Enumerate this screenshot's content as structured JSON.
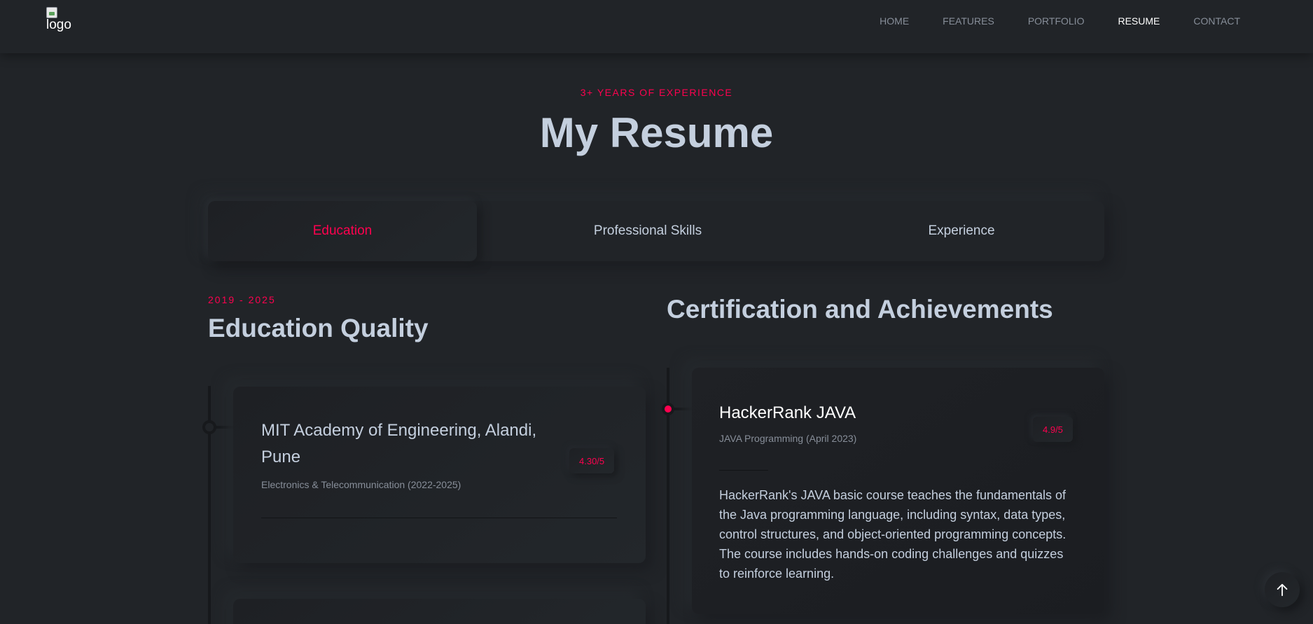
{
  "header": {
    "logo_alt": "logo",
    "nav": [
      {
        "label": "HOME",
        "active": false
      },
      {
        "label": "FEATURES",
        "active": false
      },
      {
        "label": "PORTFOLIO",
        "active": false
      },
      {
        "label": "RESUME",
        "active": true
      },
      {
        "label": "CONTACT",
        "active": false
      }
    ]
  },
  "hero": {
    "subtitle": "3+ YEARS OF EXPERIENCE",
    "title": "My Resume"
  },
  "tabs": [
    {
      "label": "Education",
      "active": true
    },
    {
      "label": "Professional Skills",
      "active": false
    },
    {
      "label": "Experience",
      "active": false
    }
  ],
  "education": {
    "period": "2019 - 2025",
    "title": "Education Quality",
    "items": [
      {
        "heading": "MIT Academy of Engineering, Alandi, Pune",
        "sub": "Electronics & Telecommunication (2022-2025)",
        "score": "4.30/5"
      }
    ]
  },
  "certifications": {
    "title": "Certification and Achievements",
    "items": [
      {
        "heading": "HackerRank JAVA",
        "sub": "JAVA Programming (April 2023)",
        "score": "4.9/5",
        "description": "HackerRank's JAVA basic course teaches the fundamentals of the Java programming language, including syntax, data types, control structures, and object-oriented programming concepts. The course includes hands-on coding challenges and quizzes to reinforce learning."
      }
    ]
  },
  "icons": {
    "scroll_top": "arrow-up-icon"
  },
  "colors": {
    "background": "#212428",
    "accent": "#ff014f",
    "text": "#c4cfde",
    "muted": "#878e99"
  }
}
